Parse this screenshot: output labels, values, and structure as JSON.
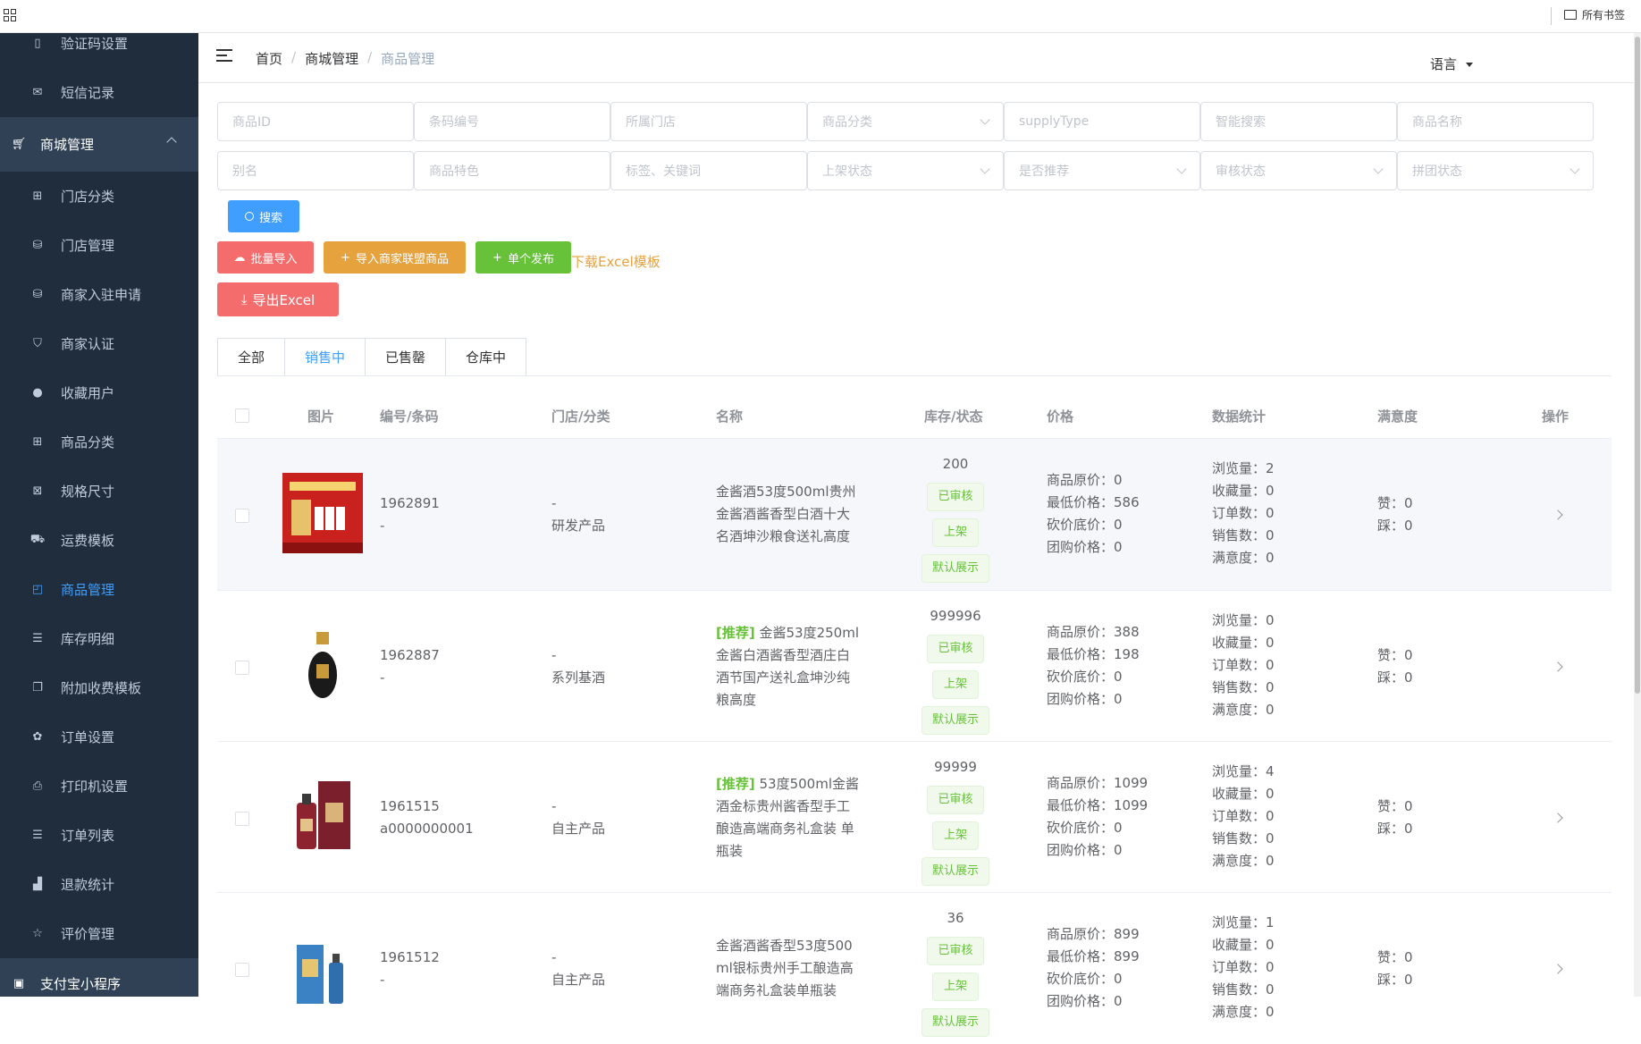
{
  "bookmark_bar": {
    "folder_label": "所有书签"
  },
  "sidebar": {
    "items_top": [
      {
        "label": "验证码设置",
        "icon": "document-icon"
      },
      {
        "label": "短信记录",
        "icon": "mail-icon"
      }
    ],
    "parent": {
      "label": "商城管理",
      "icon": "cart-icon"
    },
    "items": [
      {
        "label": "门店分类",
        "icon": "grid-icon",
        "active": false
      },
      {
        "label": "门店管理",
        "icon": "database-icon",
        "active": false
      },
      {
        "label": "商家入驻申请",
        "icon": "database-icon",
        "active": false
      },
      {
        "label": "商家认证",
        "icon": "shield-icon",
        "active": false
      },
      {
        "label": "收藏用户",
        "icon": "user-icon",
        "active": false
      },
      {
        "label": "商品分类",
        "icon": "grid-icon",
        "active": false
      },
      {
        "label": "规格尺寸",
        "icon": "ruler-icon",
        "active": false
      },
      {
        "label": "运费模板",
        "icon": "truck-icon",
        "active": true
      },
      {
        "label": "商品管理",
        "icon": "bag-icon",
        "active": true
      },
      {
        "label": "库存明细",
        "icon": "list-icon",
        "active": false
      },
      {
        "label": "附加收费模板",
        "icon": "copy-icon",
        "active": false
      },
      {
        "label": "订单设置",
        "icon": "gear-icon",
        "active": false
      },
      {
        "label": "打印机设置",
        "icon": "printer-icon",
        "active": false
      },
      {
        "label": "订单列表",
        "icon": "list-icon",
        "active": false
      },
      {
        "label": "退款统计",
        "icon": "chart-icon",
        "active": false
      },
      {
        "label": "评价管理",
        "icon": "star-icon",
        "active": false
      }
    ],
    "bottom_parent": {
      "label": "支付宝小程序",
      "icon": "miniapp-icon"
    }
  },
  "header": {
    "breadcrumb": [
      "首页",
      "商城管理",
      "商品管理"
    ],
    "language_label": "语言"
  },
  "filters": {
    "row1": [
      {
        "placeholder": "商品ID",
        "select": false
      },
      {
        "placeholder": "条码编号",
        "select": false
      },
      {
        "placeholder": "所属门店",
        "select": false
      },
      {
        "placeholder": "商品分类",
        "select": true
      },
      {
        "placeholder": "supplyType",
        "select": false
      },
      {
        "placeholder": "智能搜索",
        "select": false
      },
      {
        "placeholder": "商品名称",
        "select": false
      }
    ],
    "row2": [
      {
        "placeholder": "别名",
        "select": false
      },
      {
        "placeholder": "商品特色",
        "select": false
      },
      {
        "placeholder": "标签、关键词",
        "select": false
      },
      {
        "placeholder": "上架状态",
        "select": true
      },
      {
        "placeholder": "是否推荐",
        "select": true
      },
      {
        "placeholder": "审核状态",
        "select": true
      },
      {
        "placeholder": "拼团状态",
        "select": true
      }
    ]
  },
  "actions": {
    "search": "搜索",
    "batch_import": "批量导入",
    "import_merchant": "导入商家联盟商品",
    "single_publish": "单个发布",
    "download_template": "下载Excel模板",
    "export_excel": "导出Excel"
  },
  "tabs": [
    "全部",
    "销售中",
    "已售罄",
    "仓库中"
  ],
  "active_tab": "销售中",
  "table": {
    "columns": [
      "图片",
      "编号/条码",
      "门店/分类",
      "名称",
      "库存/状态",
      "价格",
      "数据统计",
      "满意度",
      "操作"
    ],
    "rows": [
      {
        "id": "1962891",
        "barcode": "-",
        "store": "-",
        "category": "研发产品",
        "name_lines": [
          "金酱酒53度500ml贵州",
          "金酱酒酱香型白酒十大",
          "名酒坤沙粮食送礼高度"
        ],
        "recommended": false,
        "stock": "200",
        "audit": "已审核",
        "shelf": "上架",
        "display": "默认展示",
        "prices": [
          "商品原价：0",
          "最低价格：586",
          "砍价底价：0",
          "团购价格：0"
        ],
        "stats": [
          "浏览量：2",
          "收藏量：0",
          "订单数：0",
          "销售数：0",
          "满意度：0"
        ],
        "satisfaction": [
          "赞：0",
          "踩：0"
        ]
      },
      {
        "id": "1962887",
        "barcode": "-",
        "store": "-",
        "category": "系列基酒",
        "recommend_tag": "[推荐]",
        "name_lines": [
          "金酱53度250ml",
          "金酱白酒酱香型酒庄白",
          "酒节国产送礼盒坤沙纯",
          "粮高度"
        ],
        "recommended": true,
        "stock": "999996",
        "audit": "已审核",
        "shelf": "上架",
        "display": "默认展示",
        "prices": [
          "商品原价：388",
          "最低价格：198",
          "砍价底价：0",
          "团购价格：0"
        ],
        "stats": [
          "浏览量：0",
          "收藏量：0",
          "订单数：0",
          "销售数：0",
          "满意度：0"
        ],
        "satisfaction": [
          "赞：0",
          "踩：0"
        ]
      },
      {
        "id": "1961515",
        "barcode": "a0000000001",
        "store": "-",
        "category": "自主产品",
        "recommend_tag": "[推荐]",
        "name_lines": [
          "53度500ml金酱",
          "酒金标贵州酱香型手工",
          "酿造高端商务礼盒装 单",
          "瓶装"
        ],
        "recommended": true,
        "stock": "99999",
        "audit": "已审核",
        "shelf": "上架",
        "display": "默认展示",
        "prices": [
          "商品原价：1099",
          "最低价格：1099",
          "砍价底价：0",
          "团购价格：0"
        ],
        "stats": [
          "浏览量：4",
          "收藏量：0",
          "订单数：0",
          "销售数：0",
          "满意度：0"
        ],
        "satisfaction": [
          "赞：0",
          "踩：0"
        ]
      },
      {
        "id": "1961512",
        "barcode": "-",
        "store": "-",
        "category": "自主产品",
        "name_lines": [
          "金酱酒酱香型53度500",
          "ml银标贵州手工酿造高",
          "端商务礼盒装单瓶装"
        ],
        "recommended": false,
        "stock": "36",
        "audit": "已审核",
        "shelf": "上架",
        "display": "默认展示",
        "prices": [
          "商品原价：899",
          "最低价格：899",
          "砍价底价：0",
          "团购价格：0"
        ],
        "stats": [
          "浏览量：1",
          "收藏量：0",
          "订单数：0",
          "销售数：0",
          "满意度：0"
        ],
        "satisfaction": [
          "赞：0",
          "踩：0"
        ]
      }
    ]
  },
  "colors": {
    "sidebar_bg": "#304156",
    "primary": "#409eff",
    "danger": "#f56c6c",
    "warning": "#e6a23c",
    "success": "#67c23a"
  }
}
